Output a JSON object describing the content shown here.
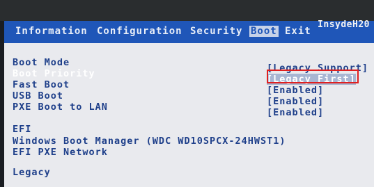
{
  "brand": "InsydeH20",
  "menu": {
    "tabs": [
      {
        "label": "Information"
      },
      {
        "label": "Configuration"
      },
      {
        "label": "Security"
      },
      {
        "label": "Boot"
      },
      {
        "label": "Exit"
      }
    ],
    "active_tab": "Boot"
  },
  "boot": {
    "items": [
      {
        "label": "Boot Mode",
        "value": "[Legacy Support]"
      },
      {
        "label": "Boot Priority",
        "value": "[Legacy First]",
        "highlighted": true
      },
      {
        "label": "Fast Boot",
        "value": "[Enabled]"
      },
      {
        "label": "USB Boot",
        "value": "[Enabled]"
      },
      {
        "label": "PXE Boot to LAN",
        "value": "[Enabled]"
      }
    ],
    "efi": {
      "heading": "EFI",
      "entries": [
        "Windows Boot Manager (WDC WD10SPCX-24HWST1)",
        "EFI PXE Network"
      ]
    },
    "legacy": {
      "heading": "Legacy"
    }
  },
  "colors": {
    "menubar": "#1f56b8",
    "screen_bg": "#e9eaee",
    "text": "#1e3f8a",
    "highlight_text": "#ffffff",
    "annotation_box": "#e02020"
  }
}
